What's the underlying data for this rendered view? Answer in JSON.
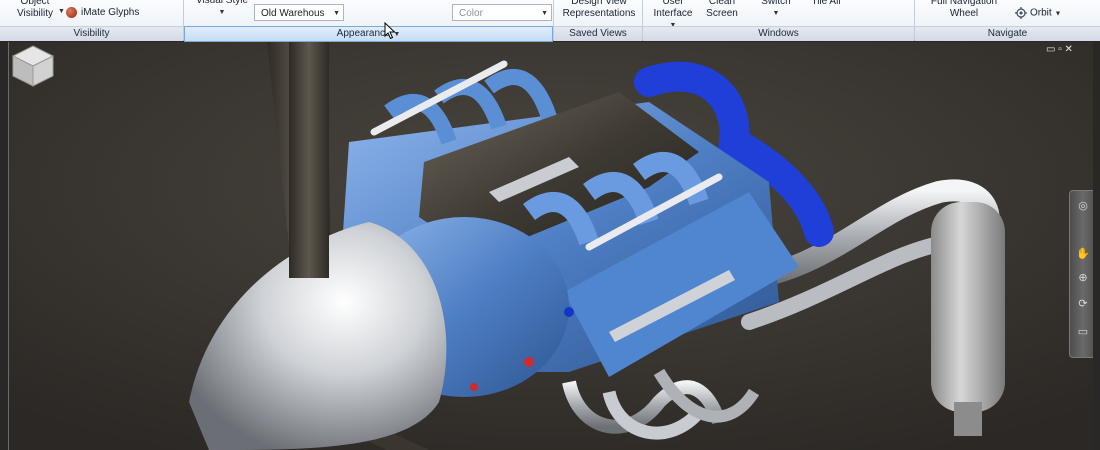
{
  "ribbon": {
    "visibility": {
      "label": "Visibility",
      "object_visibility_line1": "Object",
      "object_visibility_line2": "Visibility",
      "imate_glyphs": "iMate Glyphs"
    },
    "appearance": {
      "label": "Appearance",
      "visual_style": "Visual Style",
      "lighting_value": "Old Warehous",
      "color_value": "Color"
    },
    "saved_views": {
      "label": "Saved Views",
      "design_view_line1": "Design View",
      "design_view_line2": "Representations"
    },
    "windows": {
      "label": "Windows",
      "user_interface_line1": "User",
      "user_interface_line2": "Interface",
      "clean_screen_line1": "Clean",
      "clean_screen_line2": "Screen",
      "switch": "Switch",
      "tile_all": "Tile All"
    },
    "navigate": {
      "label": "Navigate",
      "full_nav_line1": "Full Navigation",
      "full_nav_line2": "Wheel",
      "orbit": "Orbit"
    }
  },
  "viewport": {
    "window_controls": "▭ ▫ ✕"
  },
  "colors": {
    "engine_blue": "#4f7fc4",
    "chrome": "#c9cdd2",
    "cover_dark": "#3e3a33",
    "turbo_blue": "#1f3fd8",
    "floor": "#3a3631"
  }
}
